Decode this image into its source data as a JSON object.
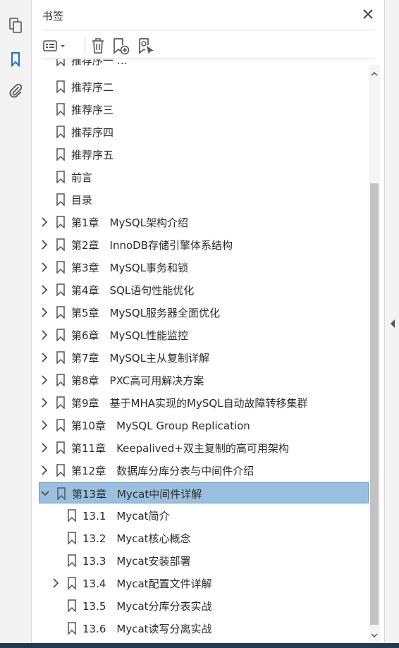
{
  "panel": {
    "title": "书签"
  },
  "icons": {
    "rail": [
      "pages-icon",
      "bookmark-icon",
      "attachment-icon"
    ],
    "toolbar": [
      "options-icon",
      "delete-icon",
      "new-bookmark-icon",
      "bookmark-from-selection-icon"
    ]
  },
  "colors": {
    "selected_bg": "#9bc0df",
    "selected_border": "#6d9ac4",
    "accent": "#1b73c4"
  },
  "tree": {
    "partial_top": "推荐序一 …",
    "items": [
      {
        "label": "推荐序二",
        "expandable": false,
        "level": 0
      },
      {
        "label": "推荐序三",
        "expandable": false,
        "level": 0
      },
      {
        "label": "推荐序四",
        "expandable": false,
        "level": 0
      },
      {
        "label": "推荐序五",
        "expandable": false,
        "level": 0
      },
      {
        "label": "前言",
        "expandable": false,
        "level": 0
      },
      {
        "label": "目录",
        "expandable": false,
        "level": 0
      },
      {
        "label": "第1章　MySQL架构介绍",
        "expandable": true,
        "level": 0
      },
      {
        "label": "第2章　InnoDB存储引擎体系结构",
        "expandable": true,
        "level": 0
      },
      {
        "label": "第3章　MySQL事务和锁",
        "expandable": true,
        "level": 0
      },
      {
        "label": "第4章　SQL语句性能优化",
        "expandable": true,
        "level": 0
      },
      {
        "label": "第5章　MySQL服务器全面优化",
        "expandable": true,
        "level": 0
      },
      {
        "label": "第6章　MySQL性能监控",
        "expandable": true,
        "level": 0
      },
      {
        "label": "第7章　MySQL主从复制详解",
        "expandable": true,
        "level": 0
      },
      {
        "label": "第8章　PXC高可用解决方案",
        "expandable": true,
        "level": 0
      },
      {
        "label": "第9章　基于MHA实现的MySQL自动故障转移集群",
        "expandable": true,
        "level": 0
      },
      {
        "label": "第10章　MySQL Group Replication",
        "expandable": true,
        "level": 0
      },
      {
        "label": "第11章　Keepalived+双主复制的高可用架构",
        "expandable": true,
        "level": 0
      },
      {
        "label": "第12章　数据库分库分表与中间件介绍",
        "expandable": true,
        "level": 0
      },
      {
        "label": "第13章　Mycat中间件详解",
        "expandable": true,
        "expanded": true,
        "selected": true,
        "level": 0
      },
      {
        "label": "13.1　Mycat简介",
        "expandable": false,
        "level": 1
      },
      {
        "label": "13.2　Mycat核心概念",
        "expandable": false,
        "level": 1
      },
      {
        "label": "13.3　Mycat安装部署",
        "expandable": false,
        "level": 1
      },
      {
        "label": "13.4　Mycat配置文件详解",
        "expandable": true,
        "level": 1
      },
      {
        "label": "13.5　Mycat分库分表实战",
        "expandable": false,
        "level": 1
      },
      {
        "label": "13.6　Mycat读写分离实战",
        "expandable": false,
        "level": 1
      }
    ]
  }
}
